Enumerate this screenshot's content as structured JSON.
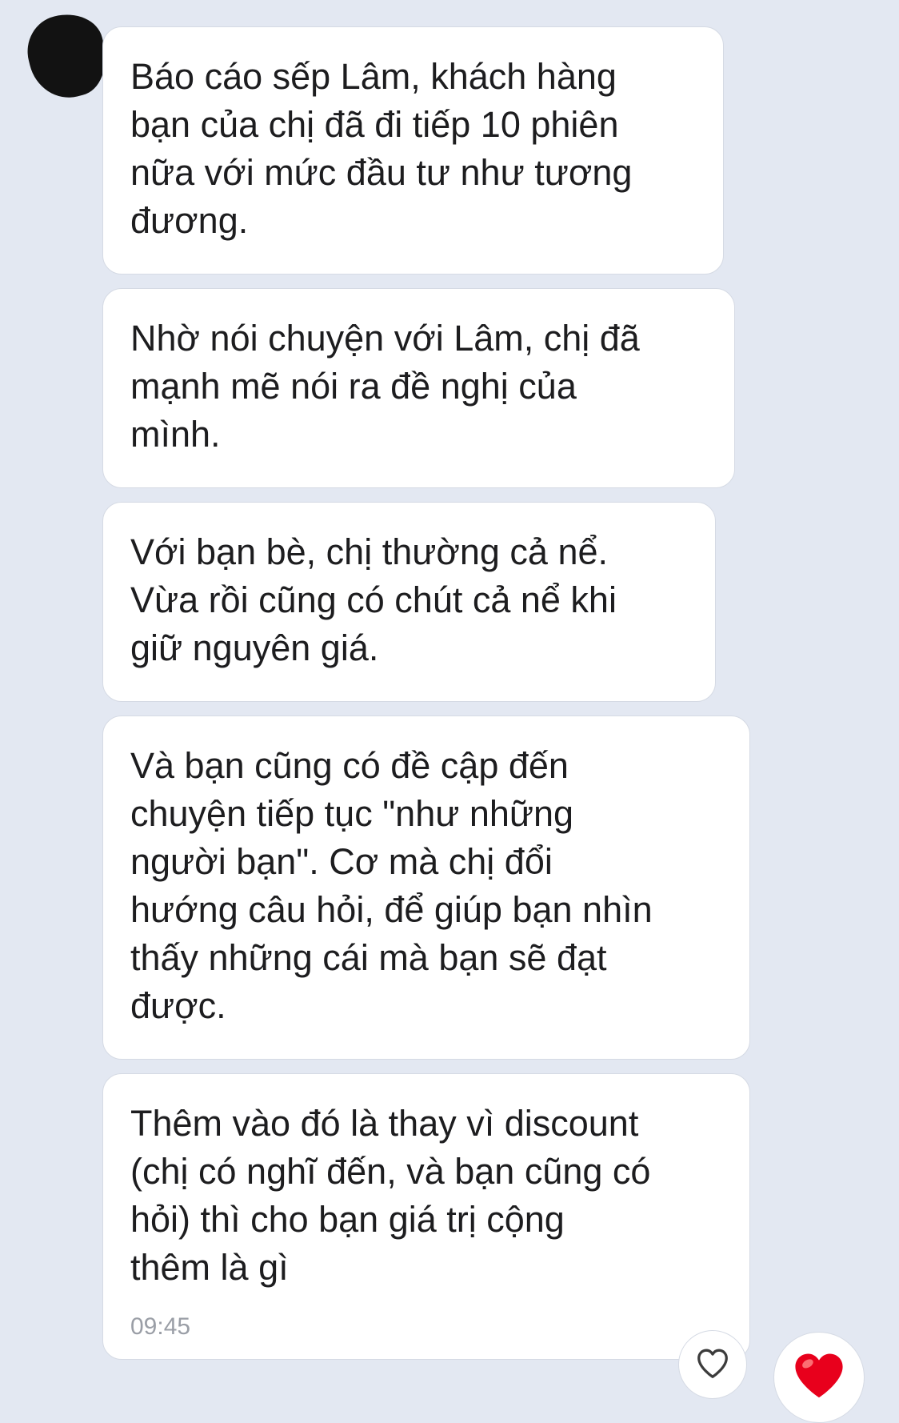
{
  "conversation": {
    "messages": [
      {
        "text": "Báo cáo sếp Lâm, khách hàng\nbạn của chị đã đi tiếp 10 phiên\nnữa với mức đầu tư như tương\nđương."
      },
      {
        "text": "Nhờ nói chuyện với Lâm, chị đã\nmạnh mẽ nói ra đề nghị của\nmình."
      },
      {
        "text": "Với bạn bè, chị thường cả nể.\nVừa rồi cũng có chút cả nể khi\ngiữ nguyên giá."
      },
      {
        "text": "Và bạn cũng có đề cập đến\nchuyện tiếp tục \"như những\nngười bạn\". Cơ mà chị đổi\nhướng câu hỏi, để giúp bạn nhìn\nthấy những cái mà bạn sẽ đạt\nđược."
      },
      {
        "text": "Thêm vào đó là thay vì discount\n(chị có nghĩ đến, và bạn cũng có\nhỏi) thì cho bạn giá trị cộng\nthêm là gì",
        "time": "09:45"
      }
    ]
  },
  "reactions": {
    "like_icon": "heart-outline-icon",
    "love_icon": "red-heart-icon"
  },
  "colors": {
    "background": "#e3e8f2",
    "bubble": "#ffffff",
    "text": "#1d1d1f",
    "timestamp": "#9a9ea6",
    "heart_red": "#e8001c"
  }
}
